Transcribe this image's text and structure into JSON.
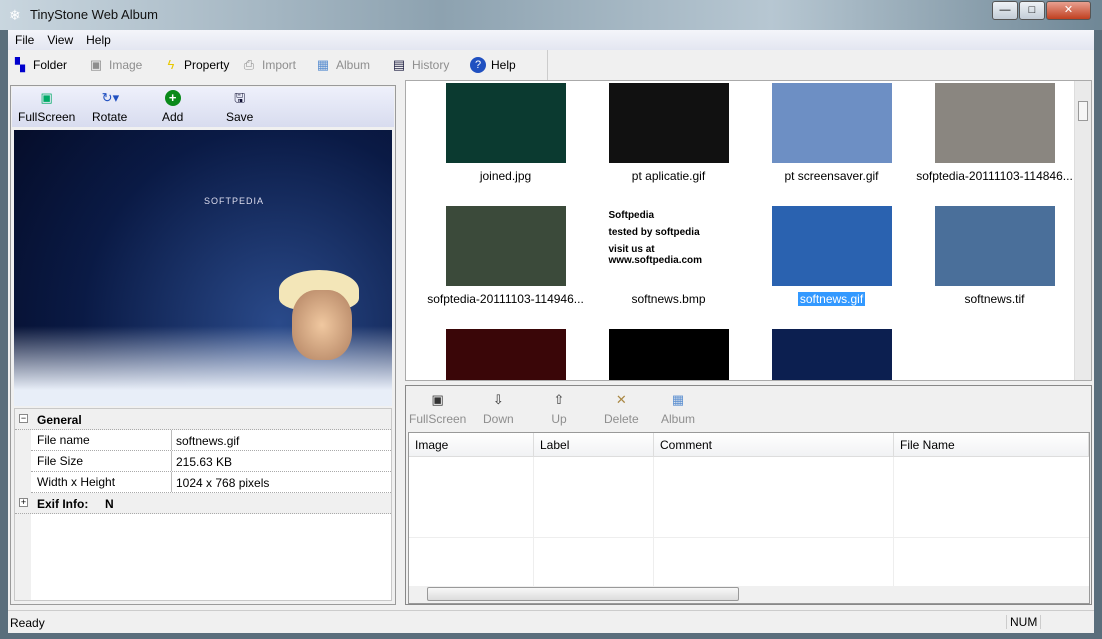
{
  "window": {
    "title": "TinyStone Web Album"
  },
  "menu": [
    "File",
    "View",
    "Help"
  ],
  "toolbar": [
    {
      "label": "Folder",
      "icon": "folder-tree-icon",
      "enabled": true
    },
    {
      "label": "Image",
      "icon": "image-icon",
      "enabled": false
    },
    {
      "label": "Property",
      "icon": "lightning-icon",
      "enabled": true
    },
    {
      "label": "Import",
      "icon": "import-icon",
      "enabled": false
    },
    {
      "label": "Album",
      "icon": "album-icon",
      "enabled": false
    },
    {
      "label": "History",
      "icon": "history-icon",
      "enabled": false
    },
    {
      "label": "Help",
      "icon": "help-icon",
      "enabled": true
    }
  ],
  "preview_toolbar": [
    "FullScreen",
    "Rotate",
    "Add",
    "Save"
  ],
  "properties": {
    "general_label": "General",
    "rows": [
      {
        "key": "File name",
        "value": "softnews.gif"
      },
      {
        "key": "File Size",
        "value": "215.63 KB"
      },
      {
        "key": "Width x Height",
        "value": "1024 x 768 pixels"
      }
    ],
    "exif_label": "Exif Info:",
    "exif_value": "N"
  },
  "preview_logo": "SOFTPEDIA",
  "thumbnails": [
    {
      "label": "joined.jpg",
      "color": "#0b3a30"
    },
    {
      "label": "pt aplicatie.gif",
      "color": "#111"
    },
    {
      "label": "pt screensaver.gif",
      "color": "#6d8fc4"
    },
    {
      "label": "sofptedia-20111103-114846...",
      "color": "#8a8680"
    },
    {
      "label": "sofptedia-20111103-114946...",
      "color": "#3b4a3a"
    },
    {
      "label": "softnews.bmp",
      "color": "#fff",
      "text": [
        "Softpedia",
        "tested by softpedia",
        "visit us at www.softpedia.com"
      ]
    },
    {
      "label": "softnews.gif",
      "color": "#2a62b0",
      "selected": true
    },
    {
      "label": "softnews.tif",
      "color": "#4a6f9a"
    },
    {
      "label": "",
      "color": "#3a0608"
    },
    {
      "label": "",
      "color": "#000"
    },
    {
      "label": "",
      "color": "#0c1f50"
    }
  ],
  "bottom_toolbar": [
    "FullScreen",
    "Down",
    "Up",
    "Delete",
    "Album"
  ],
  "list_columns": [
    "Image",
    "Label",
    "Comment",
    "File Name"
  ],
  "status": {
    "text": "Ready",
    "num": "NUM"
  }
}
